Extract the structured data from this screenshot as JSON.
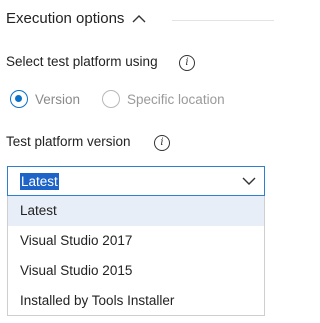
{
  "section": {
    "title": "Execution options",
    "expanded": true
  },
  "platform_select": {
    "label": "Select test platform using",
    "info_glyph": "i",
    "options": [
      {
        "label": "Version",
        "checked": true
      },
      {
        "label": "Specific location",
        "checked": false
      }
    ]
  },
  "version_field": {
    "label": "Test platform version",
    "info_glyph": "i",
    "selected_value": "Latest",
    "options": [
      "Latest",
      "Visual Studio 2017",
      "Visual Studio 2015",
      "Installed by Tools Installer"
    ]
  },
  "colors": {
    "accent": "#0a73c8",
    "selection_highlight": "#1e64c8",
    "selected_option_bg": "#e8eef8"
  },
  "icons": {
    "section_toggle": "chevron-up-icon",
    "dropdown_toggle": "chevron-down-icon",
    "info": "info-icon"
  }
}
